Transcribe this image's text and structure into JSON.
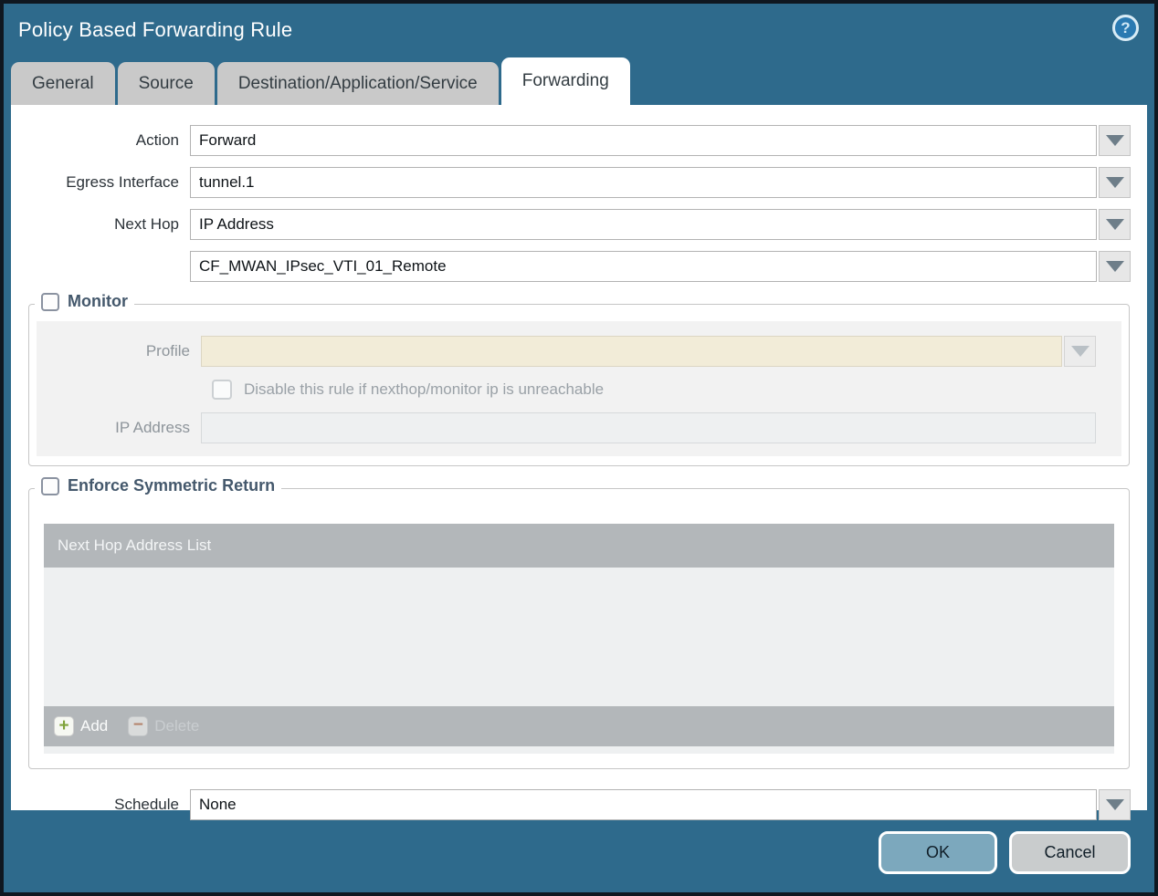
{
  "dialog": {
    "title": "Policy Based Forwarding Rule",
    "help_glyph": "?",
    "tabs": [
      {
        "label": "General",
        "active": false
      },
      {
        "label": "Source",
        "active": false
      },
      {
        "label": "Destination/Application/Service",
        "active": false
      },
      {
        "label": "Forwarding",
        "active": true
      }
    ]
  },
  "form": {
    "action": {
      "label": "Action",
      "value": "Forward"
    },
    "egress_interface": {
      "label": "Egress Interface",
      "value": "tunnel.1"
    },
    "next_hop": {
      "label": "Next Hop",
      "value": "IP Address"
    },
    "next_hop_address": {
      "value": "CF_MWAN_IPsec_VTI_01_Remote"
    },
    "schedule": {
      "label": "Schedule",
      "value": "None"
    }
  },
  "monitor": {
    "legend": "Monitor",
    "checked": false,
    "profile": {
      "label": "Profile",
      "value": ""
    },
    "disable_rule": {
      "label": "Disable this rule if nexthop/monitor ip is unreachable",
      "checked": false
    },
    "ip_address": {
      "label": "IP Address",
      "value": ""
    }
  },
  "symmetric_return": {
    "legend": "Enforce Symmetric Return",
    "checked": false,
    "table": {
      "header": "Next Hop Address List",
      "rows": []
    },
    "add_label": "Add",
    "delete_label": "Delete",
    "add_glyph": "+",
    "delete_glyph": "−"
  },
  "footer": {
    "ok_label": "OK",
    "cancel_label": "Cancel"
  },
  "colors": {
    "titlebar": "#2e6a8c",
    "window_border": "#0f1720",
    "inactive_tab": "#c9c9c9",
    "active_tab": "#ffffff",
    "legend_text": "#44586c",
    "disabled_field_cream": "#f2ecd8",
    "table_header": "#b3b7ba",
    "ok_button": "#7ca8bd",
    "cancel_button": "#c9cccd",
    "add_plus_green": "#7fa33a",
    "delete_minus_brown": "#b4846d"
  }
}
